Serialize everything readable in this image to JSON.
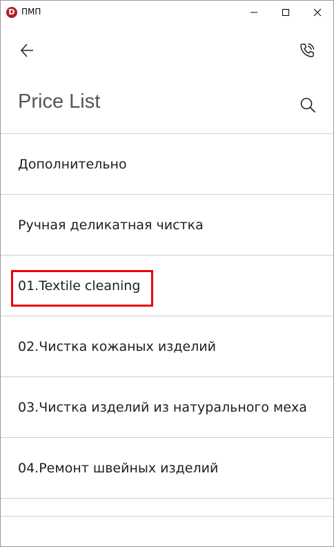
{
  "window": {
    "app_icon_letter": "D",
    "title": "ПМП",
    "brand_color": "#b11f24"
  },
  "header": {
    "back_icon": "arrow-left-icon",
    "call_icon": "phone-call-icon",
    "title": "Price List",
    "search_icon": "search-icon"
  },
  "list": {
    "items": [
      {
        "label": "Дополнительно"
      },
      {
        "label": "Ручная деликатная чистка"
      },
      {
        "label": "01.Textile cleaning",
        "highlighted": true
      },
      {
        "label": "02.Чистка кожаных изделий"
      },
      {
        "label": "03.Чистка изделий из натурального меха"
      },
      {
        "label": "04.Ремонт швейных изделий"
      }
    ]
  },
  "colors": {
    "highlight": "#e8000b",
    "title_text": "#555555",
    "item_text": "#202020",
    "divider": "#cfcfcf"
  }
}
